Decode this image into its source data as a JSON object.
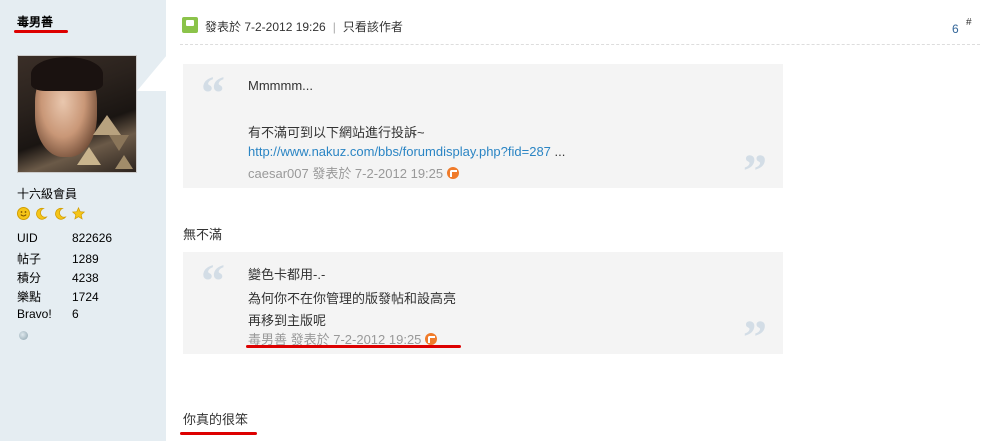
{
  "author": {
    "username": "毒男善",
    "rank": "十六級會員",
    "stats": [
      {
        "key": "UID",
        "value": "822626"
      },
      {
        "key": "帖子",
        "value": "1289"
      },
      {
        "key": "積分",
        "value": "4238"
      },
      {
        "key": "樂點",
        "value": "1724"
      },
      {
        "key": "Bravo!",
        "value": "6"
      }
    ],
    "medal_icons": [
      "smiley-icon",
      "moon-icon",
      "moon-icon",
      "star-icon"
    ]
  },
  "post": {
    "posted_label": "發表於 7-2-2012 19:26",
    "only_author_label": "只看該作者",
    "separator": "|",
    "floor": "6",
    "floor_hash": "#"
  },
  "quote1": {
    "lines": [
      "Mmmmm...",
      "",
      "有不滿可到以下網站進行投訴~"
    ],
    "link": "http://www.nakuz.com/bbs/forumdisplay.php?fid=287",
    "link_suffix": " ...",
    "meta": "caesar007 發表於 7-2-2012 19:25"
  },
  "reply1": "無不滿",
  "quote2": {
    "lines": [
      "變色卡都用-.-",
      "為何你不在你管理的版發帖和設高亮",
      "再移到主版呢"
    ],
    "meta": "毒男善 發表於 7-2-2012 19:25"
  },
  "reply2": "你真的很笨",
  "colors": {
    "sidebar_bg": "#e5edf2",
    "link": "#2b85c4",
    "annotation_red": "#dd0000",
    "post_icon_green": "#8bc34a"
  }
}
